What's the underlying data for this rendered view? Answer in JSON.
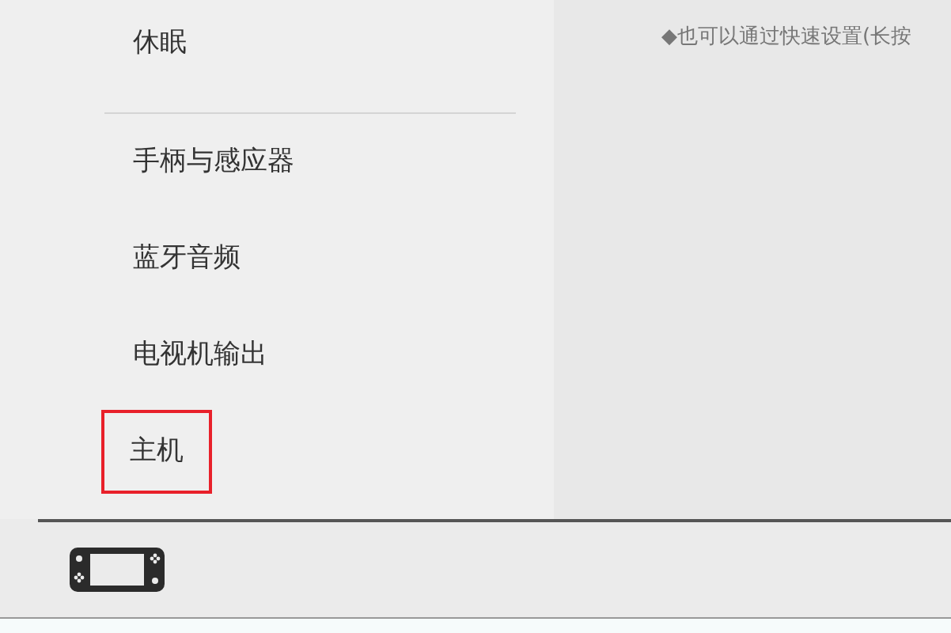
{
  "sidebar": {
    "items": [
      {
        "label": "休眠",
        "highlighted": false,
        "group_end": true
      },
      {
        "label": "手柄与感应器",
        "highlighted": false,
        "group_end": false
      },
      {
        "label": "蓝牙音频",
        "highlighted": false,
        "group_end": false
      },
      {
        "label": "电视机输出",
        "highlighted": false,
        "group_end": false
      },
      {
        "label": "主机",
        "highlighted": true,
        "group_end": false
      }
    ]
  },
  "content": {
    "note": "◆也可以通过快速设置(长按"
  }
}
